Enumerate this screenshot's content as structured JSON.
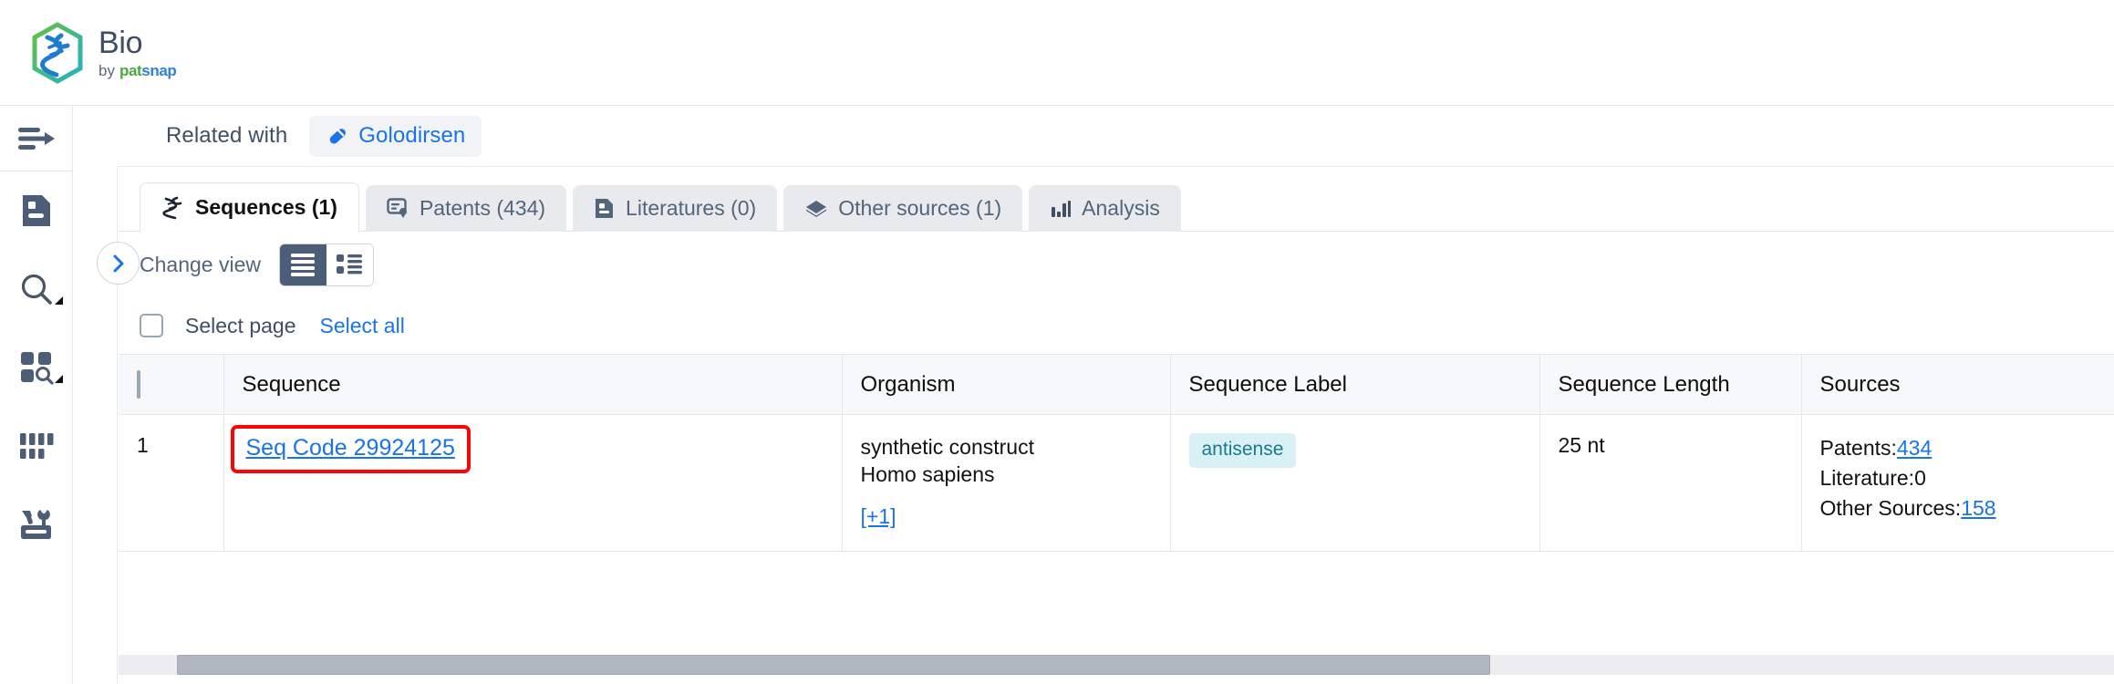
{
  "brand": {
    "title": "Bio",
    "by": "by ",
    "pat": "pat",
    "snap": "snap",
    "logo_colors": {
      "hex_green": "#5BB544",
      "hex_teal": "#2BB3C0",
      "helix_blue": "#1F7BD0"
    }
  },
  "rail": {
    "items": [
      {
        "name": "expand-panel-icon",
        "label": "Expand"
      },
      {
        "name": "document-icon",
        "label": "Documents"
      },
      {
        "name": "search-icon",
        "label": "Search"
      },
      {
        "name": "grid-search-icon",
        "label": "Structure search"
      },
      {
        "name": "columns-icon",
        "label": "Batch"
      },
      {
        "name": "tools-icon",
        "label": "Tools"
      }
    ]
  },
  "related": {
    "label": "Related with",
    "chip_label": "Golodirsen",
    "chip_icon": "capsule-icon",
    "accent": "#1a73e8"
  },
  "tabs": [
    {
      "label": "Sequences (1)",
      "icon": "dna-icon",
      "active": true
    },
    {
      "label": "Patents (434)",
      "icon": "patent-icon",
      "active": false
    },
    {
      "label": "Literatures (0)",
      "icon": "literature-icon",
      "active": false
    },
    {
      "label": "Other sources (1)",
      "icon": "box-icon",
      "active": false
    },
    {
      "label": "Analysis",
      "icon": "bar-chart-icon",
      "active": false
    }
  ],
  "toolbar": {
    "change_view_label": "Change view",
    "view_list_icon": "list-view-icon",
    "view_detail_icon": "detail-view-icon",
    "active_view": "list"
  },
  "selection": {
    "select_page_label": "Select page",
    "select_all_label": "Select all",
    "checked": false
  },
  "table": {
    "columns": [
      "",
      "Sequence",
      "Organism",
      "Sequence Label",
      "Sequence Length",
      "Sources"
    ],
    "rows": [
      {
        "index": "1",
        "sequence": "Seq Code 29924125",
        "sequence_highlighted": true,
        "highlight_color": "#fb0505",
        "organism": [
          "synthetic construct",
          "Homo sapiens"
        ],
        "organism_more": "[+1]",
        "sequence_label": "antisense",
        "sequence_length": "25 nt",
        "sources": [
          {
            "label": "Patents:",
            "value": "434",
            "linked": true
          },
          {
            "label": "Literature:",
            "value": "0",
            "linked": false
          },
          {
            "label": "Other Sources:",
            "value": "158",
            "linked": true
          }
        ]
      }
    ]
  },
  "scrollbar": {
    "orientation": "horizontal",
    "thumb_fraction": "0.80"
  }
}
